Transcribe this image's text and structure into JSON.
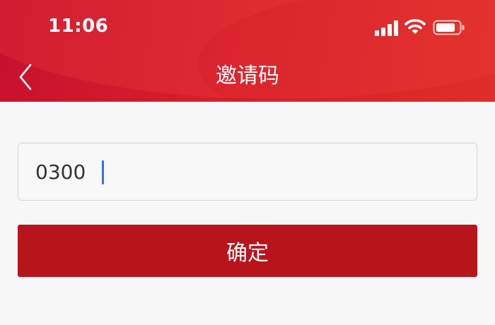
{
  "status_bar": {
    "time": "11:06",
    "icons": [
      "signal-icon",
      "wifi-icon",
      "battery-icon"
    ]
  },
  "nav": {
    "title": "邀请码",
    "back_icon": "chevron-left-icon"
  },
  "form": {
    "code_value": "0300",
    "confirm_label": "确定"
  },
  "colors": {
    "header_start": "#c8102e",
    "header_end": "#e4352a",
    "button": "#b8141c",
    "caret": "#3b6fd8",
    "background": "#f7f7f7"
  }
}
